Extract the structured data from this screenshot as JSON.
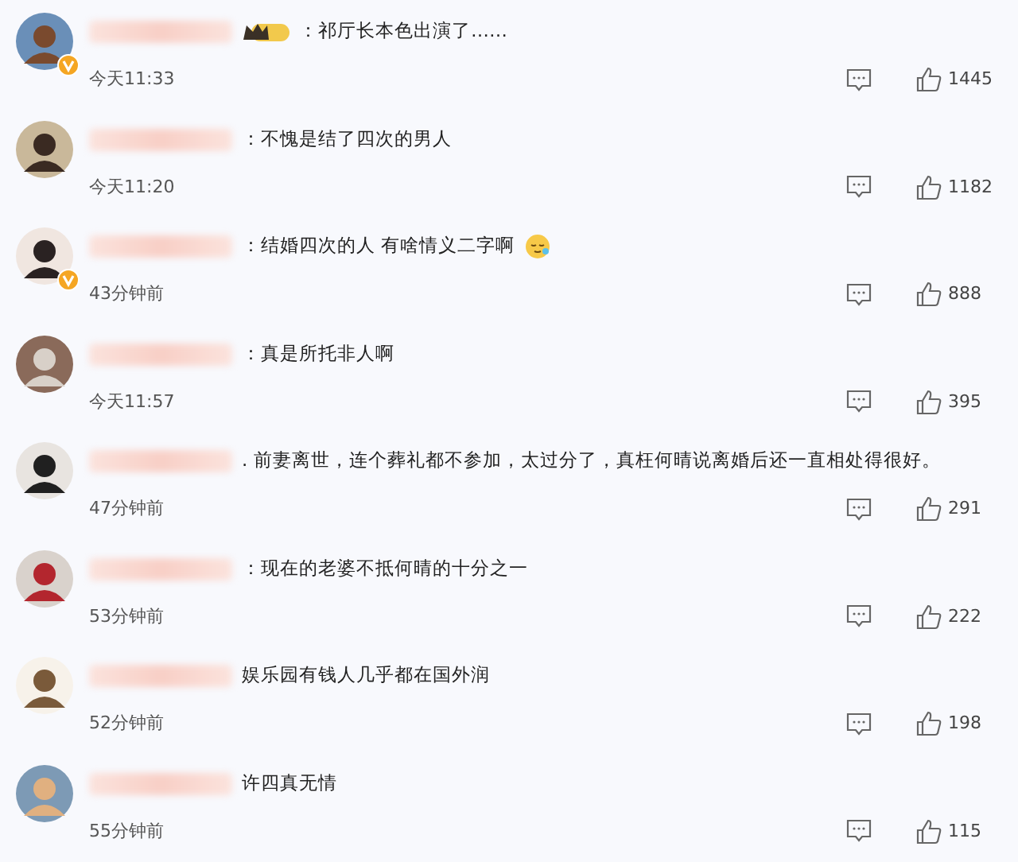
{
  "comments": [
    {
      "vip": true,
      "verified": true,
      "emoji": false,
      "text": "：祁厅长本色出演了……",
      "time": "今天11:33",
      "likes": "1445"
    },
    {
      "vip": false,
      "verified": false,
      "emoji": false,
      "text": "：不愧是结了四次的男人",
      "time": "今天11:20",
      "likes": "1182"
    },
    {
      "vip": false,
      "verified": true,
      "emoji": true,
      "text": "：结婚四次的人 有啥情义二字啊",
      "time": "43分钟前",
      "likes": "888"
    },
    {
      "vip": false,
      "verified": false,
      "emoji": false,
      "text": "：真是所托非人啊",
      "time": "今天11:57",
      "likes": "395"
    },
    {
      "vip": false,
      "verified": false,
      "emoji": false,
      "text": ". 前妻离世，连个葬礼都不参加，太过分了，真枉何晴说离婚后还一直相处得很好。",
      "time": "47分钟前",
      "likes": "291"
    },
    {
      "vip": false,
      "verified": false,
      "emoji": false,
      "text": "：现在的老婆不抵何晴的十分之一",
      "time": "53分钟前",
      "likes": "222"
    },
    {
      "vip": false,
      "verified": false,
      "emoji": false,
      "text": "娱乐园有钱人几乎都在国外润",
      "time": "52分钟前",
      "likes": "198"
    },
    {
      "vip": false,
      "verified": false,
      "emoji": false,
      "text": "许四真无情",
      "time": "55分钟前",
      "likes": "115"
    }
  ]
}
